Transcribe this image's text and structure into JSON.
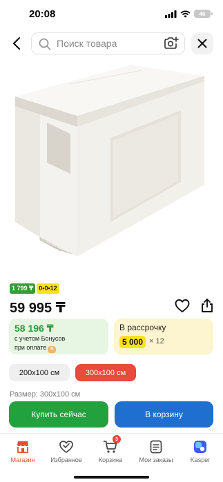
{
  "status_bar": {
    "time": "20:08",
    "battery": "46"
  },
  "search": {
    "placeholder": "Поиск товара"
  },
  "product": {
    "promo_badge_green": "1 799 ₸",
    "promo_badge_yellow": "0•0•12",
    "price": "59 995 ₸",
    "bonus": {
      "price": "58 196 ₸",
      "line1": "с учетом Бонусов",
      "line2": "при оплате"
    },
    "installment": {
      "title": "В рассрочку",
      "amount": "5 000",
      "multiplier": "× 12"
    },
    "sizes": [
      "200x100 см",
      "300x100 см"
    ],
    "selected_size_index": 1,
    "size_label": "Размер: 300x100 см"
  },
  "actions": {
    "buy_now": "Купить сейчас",
    "add_to_cart": "В корзину"
  },
  "tab_bar": {
    "items": [
      {
        "label": "Магазин",
        "icon": "shop-icon",
        "active": true
      },
      {
        "label": "Избранное",
        "icon": "favorites-icon"
      },
      {
        "label": "Корзина",
        "icon": "cart-icon",
        "badge": "3"
      },
      {
        "label": "Мои заказы",
        "icon": "orders-icon"
      },
      {
        "label": "Kasper",
        "icon": "kasper-icon"
      }
    ]
  },
  "colors": {
    "accent_red": "#e84a3b",
    "buy_green": "#22a13f",
    "cart_blue": "#1e6fd0",
    "bonus_bg": "#e7f5e3",
    "installment_bg": "#fdf5d0",
    "highlight_yellow": "#f8e11d"
  }
}
